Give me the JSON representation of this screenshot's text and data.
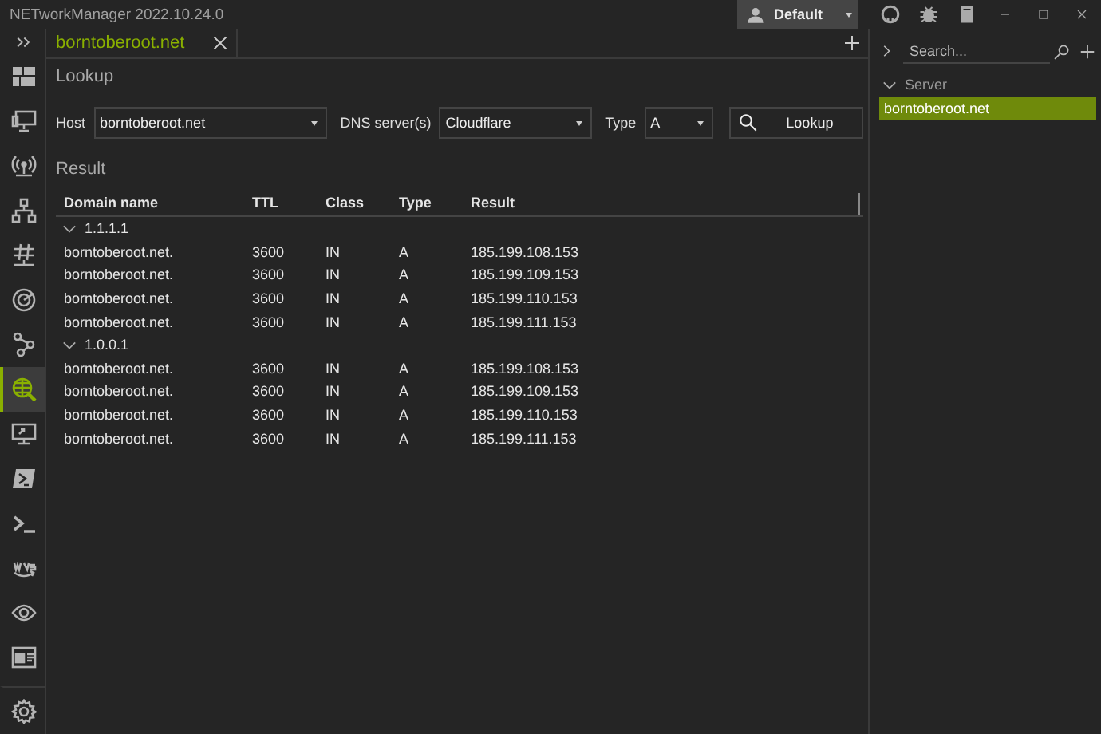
{
  "window": {
    "title": "NETworkManager 2022.10.24.0",
    "profile": "Default"
  },
  "sidebar": {
    "items": [
      {
        "kind": "dashboard",
        "selected": false
      },
      {
        "kind": "monitor",
        "selected": false
      },
      {
        "kind": "wireless",
        "selected": false
      },
      {
        "kind": "network",
        "selected": false
      },
      {
        "kind": "hash",
        "selected": false
      },
      {
        "kind": "radar",
        "selected": false
      },
      {
        "kind": "nodes",
        "selected": false
      },
      {
        "kind": "globe-search",
        "selected": true
      },
      {
        "kind": "remote",
        "selected": false
      },
      {
        "kind": "powershell",
        "selected": false
      },
      {
        "kind": "terminal",
        "selected": false
      },
      {
        "kind": "cloud",
        "selected": false
      },
      {
        "kind": "eye",
        "selected": false
      },
      {
        "kind": "card",
        "selected": false
      },
      {
        "kind": "settings",
        "selected": false
      }
    ]
  },
  "tabs": [
    {
      "label": "borntoberoot.net",
      "selected": true
    }
  ],
  "lookup": {
    "heading": "Lookup",
    "host_label": "Host",
    "host": "borntoberoot.net",
    "dns_label": "DNS server(s)",
    "dns": "Cloudflare",
    "type_label": "Type",
    "type": "A",
    "button": "Lookup"
  },
  "result": {
    "heading": "Result",
    "columns": [
      "Domain name",
      "TTL",
      "Class",
      "Type",
      "Result"
    ],
    "groups": [
      {
        "name": "1.1.1.1",
        "expanded": true,
        "rows": [
          [
            "borntoberoot.net.",
            "3600",
            "IN",
            "A",
            "185.199.108.153"
          ],
          [
            "borntoberoot.net.",
            "3600",
            "IN",
            "A",
            "185.199.109.153"
          ],
          [
            "borntoberoot.net.",
            "3600",
            "IN",
            "A",
            "185.199.110.153"
          ],
          [
            "borntoberoot.net.",
            "3600",
            "IN",
            "A",
            "185.199.111.153"
          ]
        ]
      },
      {
        "name": "1.0.0.1",
        "expanded": true,
        "rows": [
          [
            "borntoberoot.net.",
            "3600",
            "IN",
            "A",
            "185.199.108.153"
          ],
          [
            "borntoberoot.net.",
            "3600",
            "IN",
            "A",
            "185.199.109.153"
          ],
          [
            "borntoberoot.net.",
            "3600",
            "IN",
            "A",
            "185.199.110.153"
          ],
          [
            "borntoberoot.net.",
            "3600",
            "IN",
            "A",
            "185.199.111.153"
          ]
        ]
      }
    ]
  },
  "profiles": {
    "search": {
      "placeholder": "Search..."
    },
    "groups": [
      {
        "name": "Server",
        "expanded": true,
        "items": [
          {
            "label": "borntoberoot.net",
            "selected": true
          }
        ]
      }
    ]
  }
}
